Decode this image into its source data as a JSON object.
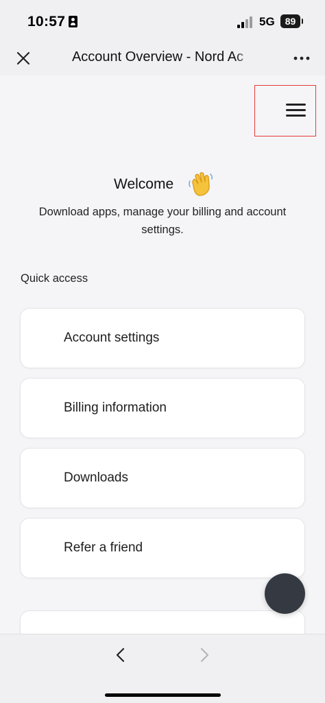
{
  "status_bar": {
    "time": "10:57",
    "network": "5G",
    "battery": "89"
  },
  "browser": {
    "title": "Account Overview - Nord Ac",
    "close_icon": "close-icon",
    "more_icon": "more-icon",
    "back_icon": "chevron-left-icon",
    "forward_icon": "chevron-right-icon"
  },
  "page": {
    "menu_icon": "hamburger-menu-icon",
    "welcome_title": "Welcome",
    "welcome_icon": "waving-hand-icon",
    "welcome_subtitle": "Download apps, manage your billing and account settings.",
    "quick_access_label": "Quick access",
    "quick_access_items": [
      {
        "label": "Account settings"
      },
      {
        "label": "Billing information"
      },
      {
        "label": "Downloads"
      },
      {
        "label": "Refer a friend"
      }
    ]
  },
  "colors": {
    "background": "#f5f5f7",
    "card": "#ffffff",
    "highlight_border": "#e53935",
    "fab": "#353a42"
  }
}
